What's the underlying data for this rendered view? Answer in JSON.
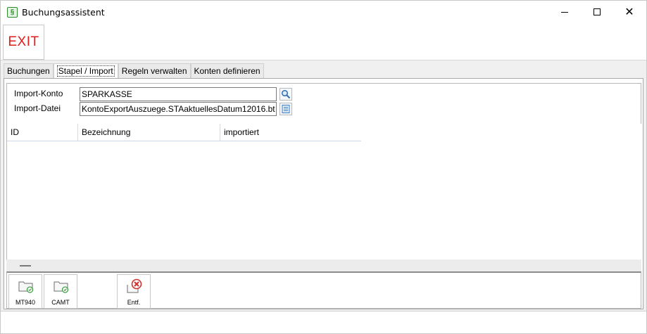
{
  "window": {
    "title": "Buchungsassistent",
    "app_icon_glyph": "§"
  },
  "toolbar": {
    "exit_label": "EXIT"
  },
  "tabs": [
    {
      "label": "Buchungen",
      "active": false
    },
    {
      "label": "Stapel / Import",
      "active": true
    },
    {
      "label": "Regeln verwalten",
      "active": false
    },
    {
      "label": "Konten definieren",
      "active": false
    }
  ],
  "import_form": {
    "konto_label": "Import-Konto",
    "konto_value": "SPARKASSE",
    "datei_label": "Import-Datei",
    "datei_value": "KontoExportAuszuege.STAaktuellesDatum12016.bt"
  },
  "grid": {
    "columns": [
      "ID",
      "Bezeichnung",
      "importiert"
    ],
    "rows": []
  },
  "buttons": {
    "mt940_label": "MT940",
    "camt_label": "CAMT",
    "entf_label": "Entf."
  },
  "icons": {
    "search": "magnifier-icon",
    "file": "file-list-icon",
    "folder": "folder-icon",
    "delete": "delete-x-icon"
  },
  "colors": {
    "exit_red": "#e21b1b",
    "accent_green": "#2e8b2e",
    "delete_red": "#d32f2f"
  }
}
